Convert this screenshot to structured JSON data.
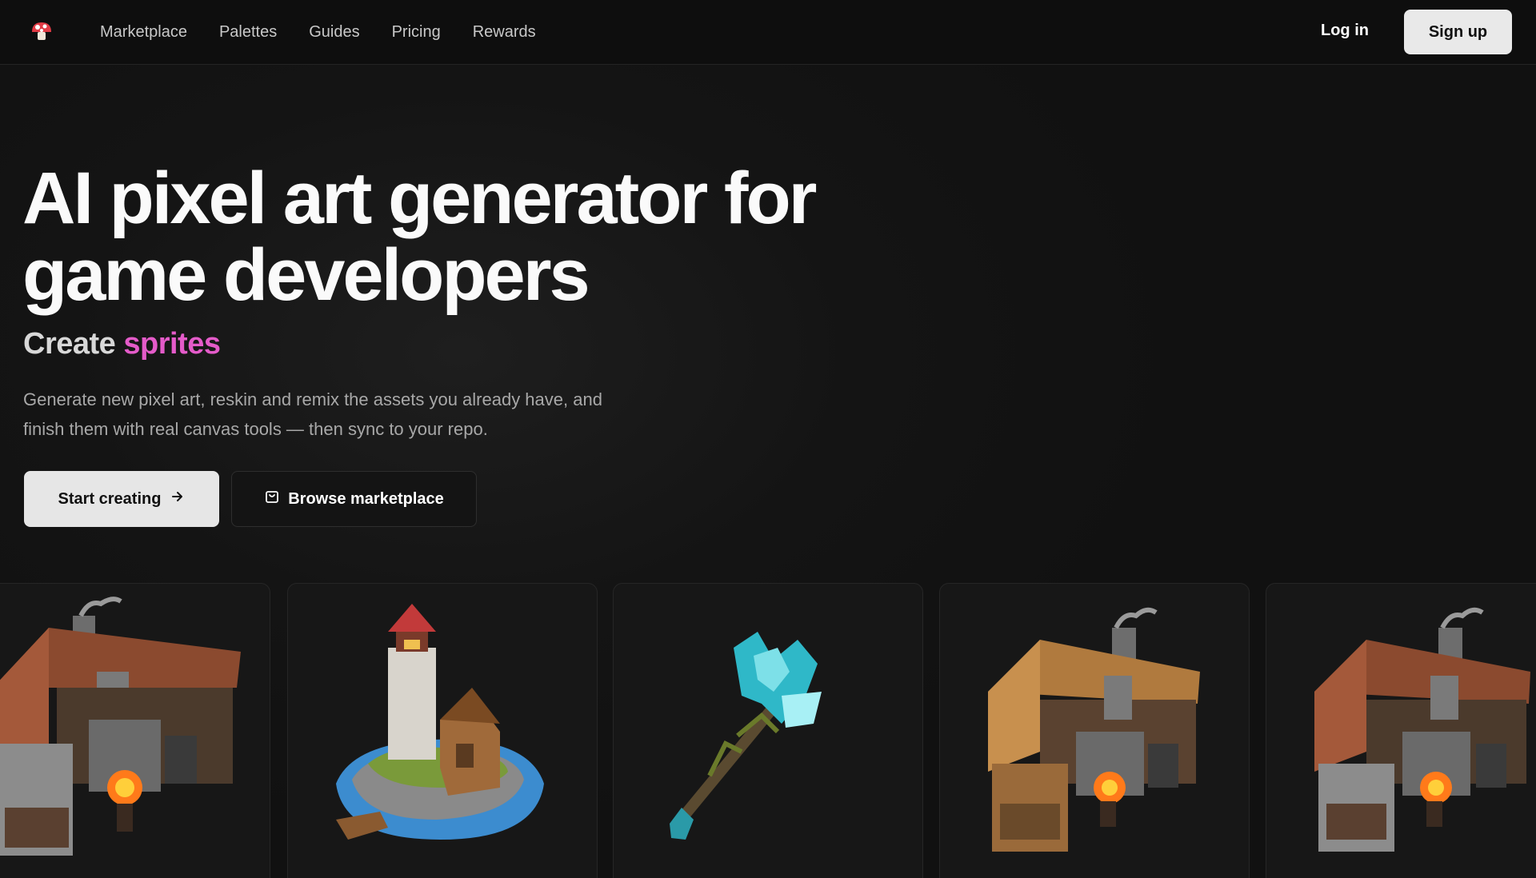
{
  "nav": {
    "logo": "mushroom-logo",
    "links": [
      "Marketplace",
      "Palettes",
      "Guides",
      "Pricing",
      "Rewards"
    ],
    "login": "Log in",
    "signup": "Sign up"
  },
  "hero": {
    "title": "AI pixel art generator for game developers",
    "subtitle_prefix": "Create",
    "subtitle_accent": "sprites",
    "description": "Generate new pixel art, reskin and remix the assets you already have, and finish them with real canvas tools — then sync to your repo.",
    "primary_button": "Start creating",
    "secondary_button": "Browse marketplace"
  },
  "colors": {
    "accent": "#e45bc9",
    "background": "#111111"
  },
  "gallery": {
    "cards": [
      {
        "subject": "blacksmith-forge"
      },
      {
        "subject": "lighthouse-island"
      },
      {
        "subject": "crystal-staff"
      },
      {
        "subject": "wooden-forge"
      },
      {
        "subject": "blacksmith-forge"
      }
    ]
  }
}
